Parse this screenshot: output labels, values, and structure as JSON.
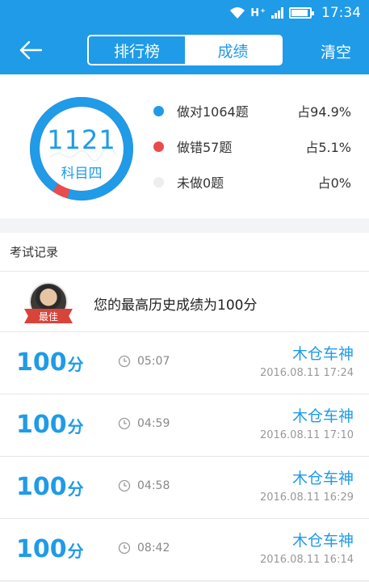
{
  "status_bar": {
    "time": "17:34",
    "signal_text": "H⁺",
    "colors": {
      "bar": "#1f9be8"
    }
  },
  "nav": {
    "tabs": [
      {
        "label": "排行榜",
        "active": false
      },
      {
        "label": "成绩",
        "active": true
      }
    ],
    "clear_label": "清空"
  },
  "summary": {
    "ring_number": "1121",
    "ring_subject": "科目四",
    "correct_fraction": 0.949,
    "wrong_fraction": 0.051,
    "stats": [
      {
        "label": "做对1064题",
        "pct": "占94.9%",
        "color": "#1f9be8"
      },
      {
        "label": "做错57题",
        "pct": "占5.1%",
        "color": "#e84c4c"
      },
      {
        "label": "未做0题",
        "pct": "占0%",
        "color": "#eeeeee"
      }
    ]
  },
  "records": {
    "section_title": "考试记录",
    "best": {
      "badge": "最佳",
      "text": "您的最高历史成绩为100分"
    },
    "items": [
      {
        "score": "100",
        "unit": "分",
        "duration": "05:07",
        "user": "木仓车神",
        "date": "2016.08.11  17:24"
      },
      {
        "score": "100",
        "unit": "分",
        "duration": "04:59",
        "user": "木仓车神",
        "date": "2016.08.11  17:10"
      },
      {
        "score": "100",
        "unit": "分",
        "duration": "04:58",
        "user": "木仓车神",
        "date": "2016.08.11  16:29"
      },
      {
        "score": "100",
        "unit": "分",
        "duration": "08:42",
        "user": "木仓车神",
        "date": "2016.08.11  16:14"
      }
    ]
  }
}
